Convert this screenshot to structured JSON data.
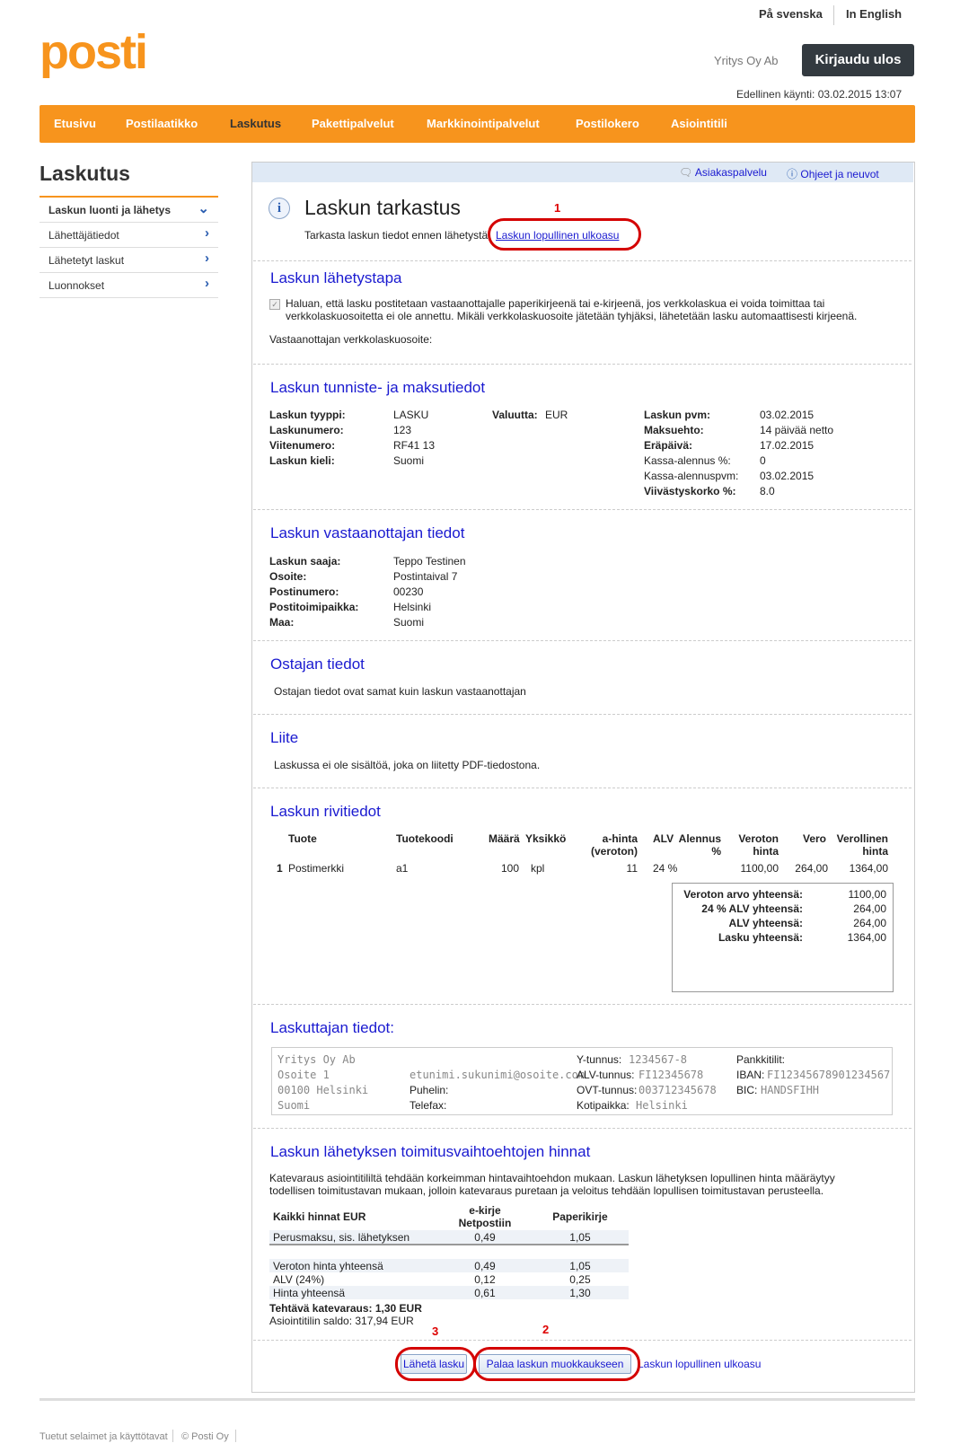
{
  "header": {
    "lang_sv": "På svenska",
    "lang_en": "In English",
    "logo": "posti",
    "company": "Yritys Oy Ab",
    "logout": "Kirjaudu ulos",
    "last_visit": "Edellinen käynti: 03.02.2015 13:07"
  },
  "nav": [
    "Etusivu",
    "Postilaatikko",
    "Laskutus",
    "Pakettipalvelut",
    "Markkinointipalvelut",
    "Postilokero",
    "Asiointitili"
  ],
  "sidebar": {
    "title": "Laskutus",
    "items": [
      "Laskun luonti ja lähetys",
      "Lähettäjätiedot",
      "Lähetetyt laskut",
      "Luonnokset"
    ]
  },
  "toolbar": {
    "support": "Asiakaspalvelu",
    "help": "Ohjeet ja neuvot"
  },
  "review": {
    "title": "Laskun tarkastus",
    "text": "Tarkasta laskun tiedot ennen lähetystä.",
    "link": "Laskun lopullinen ulkoasu",
    "annot1": "1",
    "annot2": "2",
    "annot3": "3"
  },
  "delivery": {
    "title": "Laskun lähetystapa",
    "checkbox_text_1": "Haluan, että lasku postitetaan vastaanottajalle paperikirjeenä tai e-kirjeenä, jos verkkolaskua ei voida toimittaa tai",
    "checkbox_text_2": "verkkolaskuosoitetta ei ole annettu. Mikäli verkkolaskuosoite jätetään tyhjäksi, lähetetään lasku automaattisesti kirjeenä.",
    "address_label": "Vastaanottajan verkkolaskuosoite:"
  },
  "ids": {
    "title": "Laskun tunniste- ja maksutiedot",
    "left": [
      {
        "label": "Laskun tyyppi:",
        "value": "LASKU"
      },
      {
        "label": "Laskunumero:",
        "value": "123"
      },
      {
        "label": "Viitenumero:",
        "value": "RF41 13"
      },
      {
        "label": "Laskun kieli:",
        "value": "Suomi"
      }
    ],
    "currency_label": "Valuutta:",
    "currency": "EUR",
    "right": [
      {
        "label": "Laskun pvm:",
        "value": "03.02.2015",
        "bold": true
      },
      {
        "label": "Maksuehto:",
        "value": "14 päivää netto",
        "bold": true
      },
      {
        "label": "Eräpäivä:",
        "value": "17.02.2015",
        "bold": true
      },
      {
        "label": "Kassa-alennus %:",
        "value": "0",
        "bold": false
      },
      {
        "label": "Kassa-alennuspvm:",
        "value": "03.02.2015",
        "bold": false
      },
      {
        "label": "Viivästyskorko %:",
        "value": "8.0",
        "bold": true
      }
    ]
  },
  "recipient": {
    "title": "Laskun vastaanottajan tiedot",
    "rows": [
      {
        "label": "Laskun saaja:",
        "value": "Teppo Testinen"
      },
      {
        "label": "Osoite:",
        "value": "Postintaival 7"
      },
      {
        "label": "Postinumero:",
        "value": "00230"
      },
      {
        "label": "Postitoimipaikka:",
        "value": "Helsinki"
      },
      {
        "label": "Maa:",
        "value": "Suomi"
      }
    ]
  },
  "buyer": {
    "title": "Ostajan tiedot",
    "text": "Ostajan tiedot ovat samat kuin laskun vastaanottajan"
  },
  "attachment": {
    "title": "Liite",
    "text": "Laskussa ei ole sisältöä, joka on liitetty PDF-tiedostona."
  },
  "rows": {
    "title": "Laskun rivitiedot",
    "headers": {
      "product": "Tuote",
      "code": "Tuotekoodi",
      "qty": "Määrä",
      "unit": "Yksikkö",
      "price1": "a-hinta",
      "price2": "(veroton)",
      "vat": "ALV",
      "disc1": "Alennus",
      "disc2": "%",
      "net1": "Veroton",
      "net2": "hinta",
      "tax": "Vero",
      "gross1": "Verollinen",
      "gross2": "hinta"
    },
    "line": {
      "no": "1",
      "product": "Postimerkki",
      "code": "a1",
      "qty": "100",
      "unit": "kpl",
      "price": "11",
      "vat": "24 %",
      "net": "1100,00",
      "tax": "264,00",
      "gross": "1364,00"
    },
    "totals": [
      {
        "label": "Veroton arvo yhteensä:",
        "value": "1100,00"
      },
      {
        "label": "24 % ALV yhteensä:",
        "value": "264,00"
      },
      {
        "label": "ALV yhteensä:",
        "value": "264,00"
      },
      {
        "label": "Lasku yhteensä:",
        "value": "1364,00"
      }
    ]
  },
  "biller": {
    "title": "Laskuttajan tiedot:",
    "name": "Yritys Oy Ab",
    "address": "Osoite 1",
    "postal": "00100 Helsinki",
    "country": "Suomi",
    "email": "etunimi.sukunimi@osoite.com",
    "phone_label": "Puhelin:",
    "fax_label": "Telefax:",
    "ytunnus_label": "Y-tunnus:",
    "ytunnus": "1234567-8",
    "alv_label": "ALV-tunnus:",
    "alv": "FI12345678",
    "ovt_label": "OVT-tunnus:",
    "ovt": "003712345678",
    "home_label": "Kotipaikka:",
    "home": "Helsinki",
    "bank_label": "Pankkitilit:",
    "iban_label": "IBAN:",
    "iban": "FI12345678901234567",
    "bic_label": "BIC:",
    "bic": "HANDSFIHH"
  },
  "prices": {
    "title": "Laskun lähetyksen toimitusvaihtoehtojen hinnat",
    "text1": "Katevaraus asiointitililtä tehdään korkeimman hintavaihtoehdon mukaan. Laskun lähetyksen lopullinen hinta määräytyy",
    "text2": "todellisen toimitustavan mukaan, jolloin katevaraus puretaan ja veloitus tehdään lopullisen toimitustavan perusteella.",
    "col0": "Kaikki hinnat EUR",
    "col1a": "e-kirje",
    "col1b": "Netpostiin",
    "col2": "Paperikirje",
    "rows": [
      {
        "label": "Perusmaksu, sis. lähetyksen",
        "e": "0,49",
        "p": "1,05"
      },
      {
        "label": "Veroton hinta yhteensä",
        "e": "0,49",
        "p": "1,05"
      },
      {
        "label": "ALV (24%)",
        "e": "0,12",
        "p": "0,25"
      },
      {
        "label": "Hinta yhteensä",
        "e": "0,61",
        "p": "1,30"
      }
    ],
    "reserve": "Tehtävä katevaraus: 1,30 EUR",
    "balance": "Asiointitilin saldo: 317,94 EUR"
  },
  "actions": {
    "send": "Lähetä lasku",
    "back": "Palaa laskun muokkaukseen",
    "final": "Laskun lopullinen ulkoasu"
  },
  "footer": {
    "browsers": "Tuetut selaimet ja käyttötavat",
    "copy": "© Posti Oy"
  },
  "colors": {
    "brand": "#f7941d",
    "link": "#1a1ad0",
    "annotation": "#d40000"
  }
}
